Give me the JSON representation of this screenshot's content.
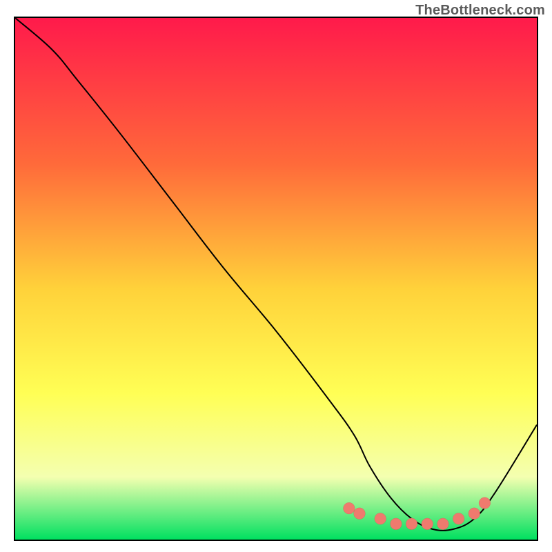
{
  "watermark": "TheBottleneck.com",
  "colors": {
    "gradient_top": "#ff1a4b",
    "gradient_25": "#ff6a3a",
    "gradient_50": "#ffd23a",
    "gradient_70": "#ffff55",
    "gradient_85": "#f4ffb0",
    "gradient_bottom": "#00e060",
    "curve": "#000000",
    "marker_fill": "#ef7a6e",
    "marker_stroke": "#c94f45"
  },
  "chart_data": {
    "type": "line",
    "title": "",
    "xlabel": "",
    "ylabel": "",
    "xlim": [
      0,
      100
    ],
    "ylim": [
      0,
      100
    ],
    "series": [
      {
        "name": "bottleneck-curve",
        "x": [
          0,
          7,
          12,
          20,
          30,
          40,
          50,
          60,
          65,
          68,
          72,
          76,
          80,
          84,
          88,
          92,
          100
        ],
        "values": [
          100,
          94,
          88,
          78,
          65,
          52,
          40,
          27,
          20,
          14,
          8,
          4,
          2,
          2,
          4,
          9,
          22
        ]
      }
    ],
    "markers": {
      "name": "highlight-dots",
      "x": [
        64,
        66,
        70,
        73,
        76,
        79,
        82,
        85,
        88,
        90
      ],
      "values": [
        6,
        5,
        4,
        3,
        3,
        3,
        3,
        4,
        5,
        7
      ]
    }
  }
}
